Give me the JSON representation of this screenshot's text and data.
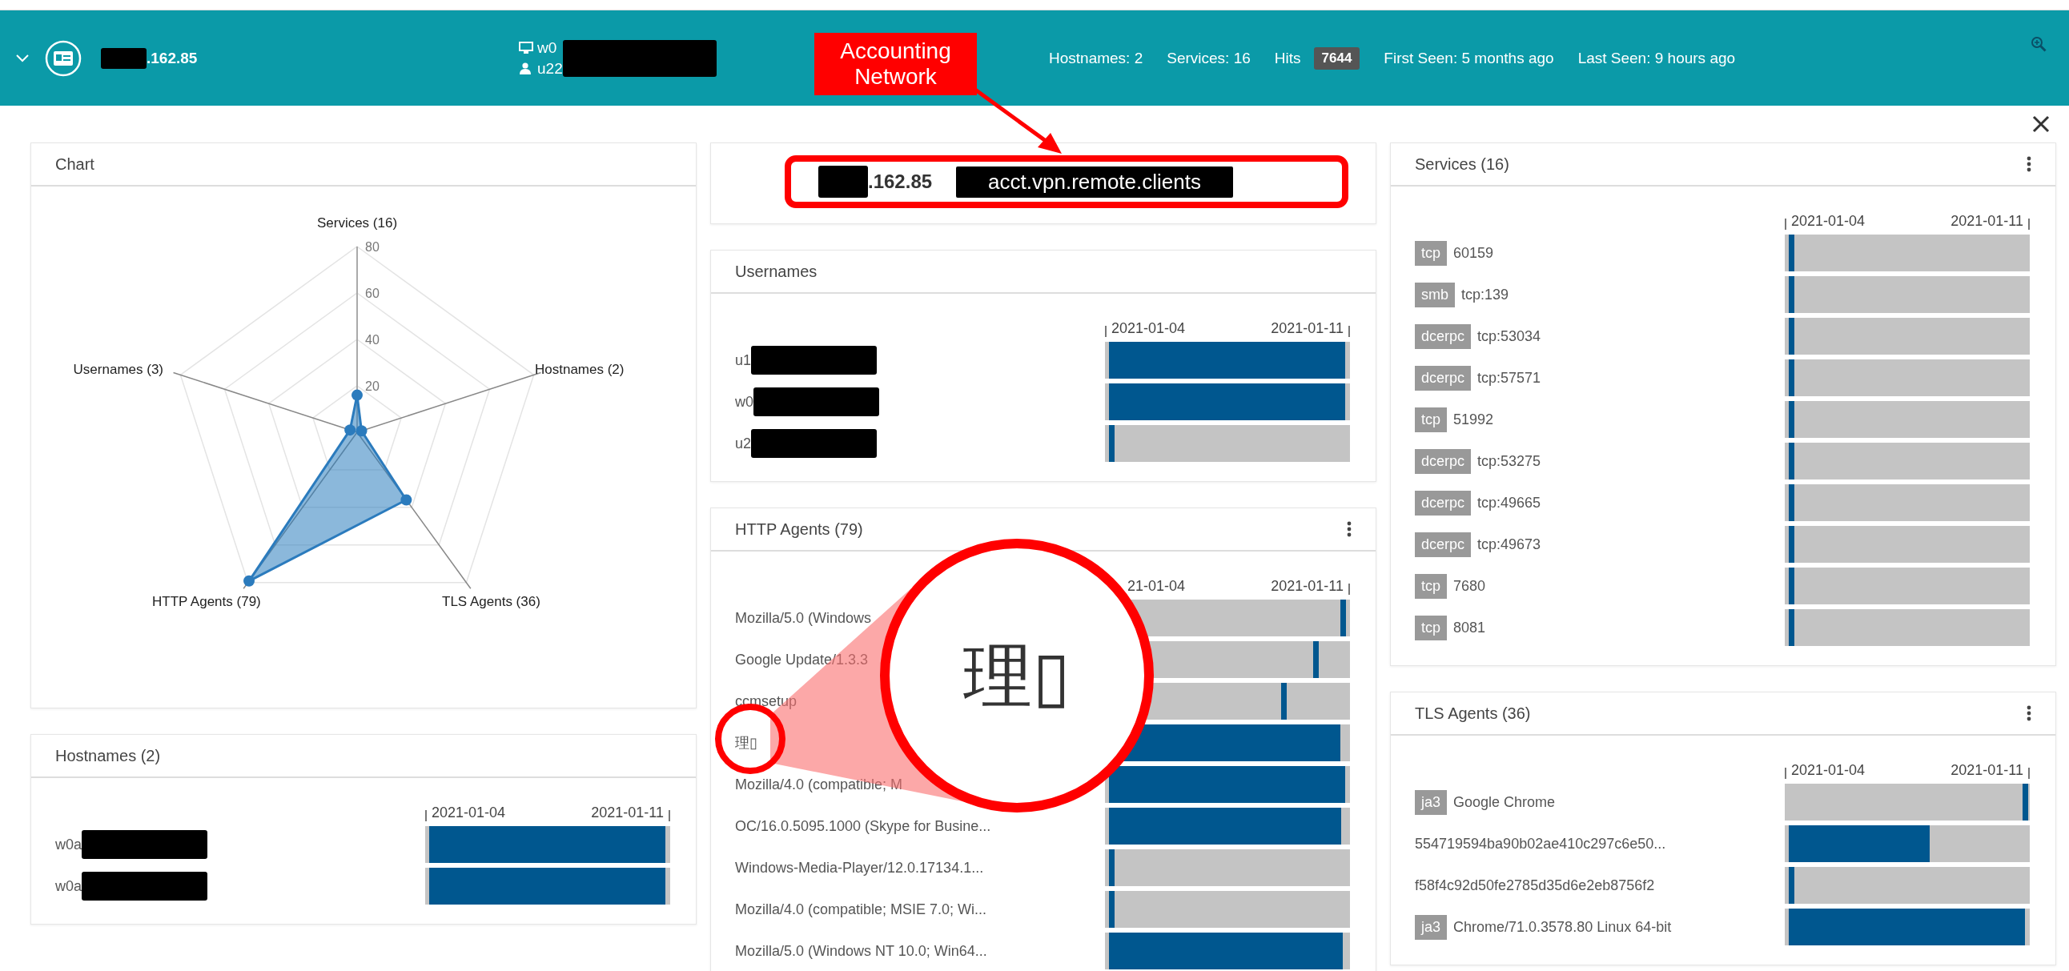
{
  "header": {
    "host": {
      "text": ".162.85",
      "redacted": true
    },
    "identity": {
      "redacted": true,
      "lines": [
        {
          "kind": "computer",
          "text": "w0"
        },
        {
          "kind": "user",
          "text": "u22"
        }
      ]
    },
    "stats": [
      {
        "label": "Hostnames: 2"
      },
      {
        "label": "Services: 16"
      },
      {
        "label": "Hits",
        "badge": "7644"
      },
      {
        "label": "First Seen: 5 months ago"
      },
      {
        "label": "Last Seen: 9 hours ago"
      }
    ]
  },
  "columns": [
    {
      "panels": [
        {
          "kind": "radar",
          "title": "Chart",
          "menu": false,
          "axes": [
            "Services (16)",
            "Usernames (3)",
            "Hostnames (2)",
            "HTTP Agents (79)",
            "TLS Agents (36)"
          ],
          "ticks": [
            "80",
            "60",
            "40",
            "20"
          ]
        },
        {
          "kind": "timeline",
          "title": "Hostnames (2)",
          "menu": false,
          "dates": [
            "2021-01-04",
            "2021-01-11"
          ],
          "rows": [
            {
              "label": "w0a",
              "redacted": true,
              "bar": {
                "kind": "span",
                "level": 0.98
              }
            },
            {
              "label": "w0a",
              "redacted": true,
              "bar": {
                "kind": "span",
                "level": 0.98
              }
            }
          ]
        }
      ]
    },
    {
      "panels": [
        {
          "kind": "summary",
          "host": ".162.85",
          "redacted": true,
          "network": "acct.vpn.remote.clients",
          "highlighted": true
        },
        {
          "kind": "timeline",
          "title": "Usernames",
          "menu": false,
          "dates": [
            "2021-01-04",
            "2021-01-11"
          ],
          "rows": [
            {
              "label": "u1",
              "redacted": true,
              "bar": {
                "kind": "span",
                "level": 0.98
              }
            },
            {
              "label": "w0",
              "redacted": true,
              "bar": {
                "kind": "span",
                "level": 0.98
              }
            },
            {
              "label": "u2",
              "redacted": true,
              "bar": {
                "kind": "tick",
                "level": 0.015
              }
            }
          ]
        },
        {
          "kind": "timeline",
          "title": "HTTP Agents (79)",
          "menu": true,
          "dates": [
            "21-01-04",
            "2021-01-11"
          ],
          "rows": [
            {
              "label": "Mozilla/5.0 (Windows",
              "bar": {
                "kind": "tick",
                "level": 0.96
              }
            },
            {
              "label": "Google Update/1.3.3",
              "bar": {
                "kind": "tick",
                "level": 0.85
              }
            },
            {
              "label": "ccmsetup",
              "bar": {
                "kind": "tick",
                "level": 0.72
              }
            },
            {
              "label": "理▯",
              "bar": {
                "kind": "span",
                "level": 0.96
              }
            },
            {
              "label": "Mozilla/4.0 (compatible; M",
              "bar": {
                "kind": "span",
                "level": 0.98
              }
            },
            {
              "label": "OC/16.0.5095.1000 (Skype for Busine...",
              "bar": {
                "kind": "span",
                "level": 0.965
              }
            },
            {
              "label": "Windows-Media-Player/12.0.17134.1...",
              "bar": {
                "kind": "tick",
                "level": 0.015
              }
            },
            {
              "label": "Mozilla/4.0 (compatible; MSIE 7.0; Wi...",
              "bar": {
                "kind": "tick",
                "level": 0.015
              }
            },
            {
              "label": "Mozilla/5.0 (Windows NT 10.0; Win64...",
              "bar": {
                "kind": "span",
                "level": 0.97
              }
            }
          ]
        }
      ]
    },
    {
      "panels": [
        {
          "kind": "timeline",
          "title": "Services (16)",
          "menu": true,
          "dates": [
            "2021-01-04",
            "2021-01-11"
          ],
          "rows": [
            {
              "tag": "tcp",
              "label": "60159",
              "bar": {
                "kind": "tick",
                "level": 0.015
              }
            },
            {
              "tag": "smb",
              "label": "tcp:139",
              "bar": {
                "kind": "tick",
                "level": 0.015
              }
            },
            {
              "tag": "dcerpc",
              "label": "tcp:53034",
              "bar": {
                "kind": "tick",
                "level": 0.015
              }
            },
            {
              "tag": "dcerpc",
              "label": "tcp:57571",
              "bar": {
                "kind": "tick",
                "level": 0.015
              }
            },
            {
              "tag": "tcp",
              "label": "51992",
              "bar": {
                "kind": "tick",
                "level": 0.015
              }
            },
            {
              "tag": "dcerpc",
              "label": "tcp:53275",
              "bar": {
                "kind": "tick",
                "level": 0.015
              }
            },
            {
              "tag": "dcerpc",
              "label": "tcp:49665",
              "bar": {
                "kind": "tick",
                "level": 0.015
              }
            },
            {
              "tag": "dcerpc",
              "label": "tcp:49673",
              "bar": {
                "kind": "tick",
                "level": 0.015
              }
            },
            {
              "tag": "tcp",
              "label": "7680",
              "bar": {
                "kind": "tick",
                "level": 0.015
              }
            },
            {
              "tag": "tcp",
              "label": "8081",
              "bar": {
                "kind": "tick",
                "level": 0.015
              }
            }
          ]
        },
        {
          "kind": "timeline",
          "title": "TLS Agents (36)",
          "menu": true,
          "dates": [
            "2021-01-04",
            "2021-01-11"
          ],
          "rows": [
            {
              "tag": "ja3",
              "label": "Google Chrome",
              "bar": {
                "kind": "tick",
                "level": 0.97
              }
            },
            {
              "label": "554719594ba90b02ae410c297c6e50...",
              "bar": {
                "kind": "span",
                "level": 0.59
              }
            },
            {
              "label": "f58f4c92d50fe2785d35d6e2eb8756f2",
              "bar": {
                "kind": "tick",
                "level": 0.015
              }
            },
            {
              "tag": "ja3",
              "label": "Chrome/71.0.3578.80 Linux 64-bit",
              "bar": {
                "kind": "span",
                "level": 0.98
              }
            }
          ]
        }
      ]
    }
  ],
  "annotations": {
    "callout": "Accounting Network",
    "magnifier": "理▯"
  }
}
